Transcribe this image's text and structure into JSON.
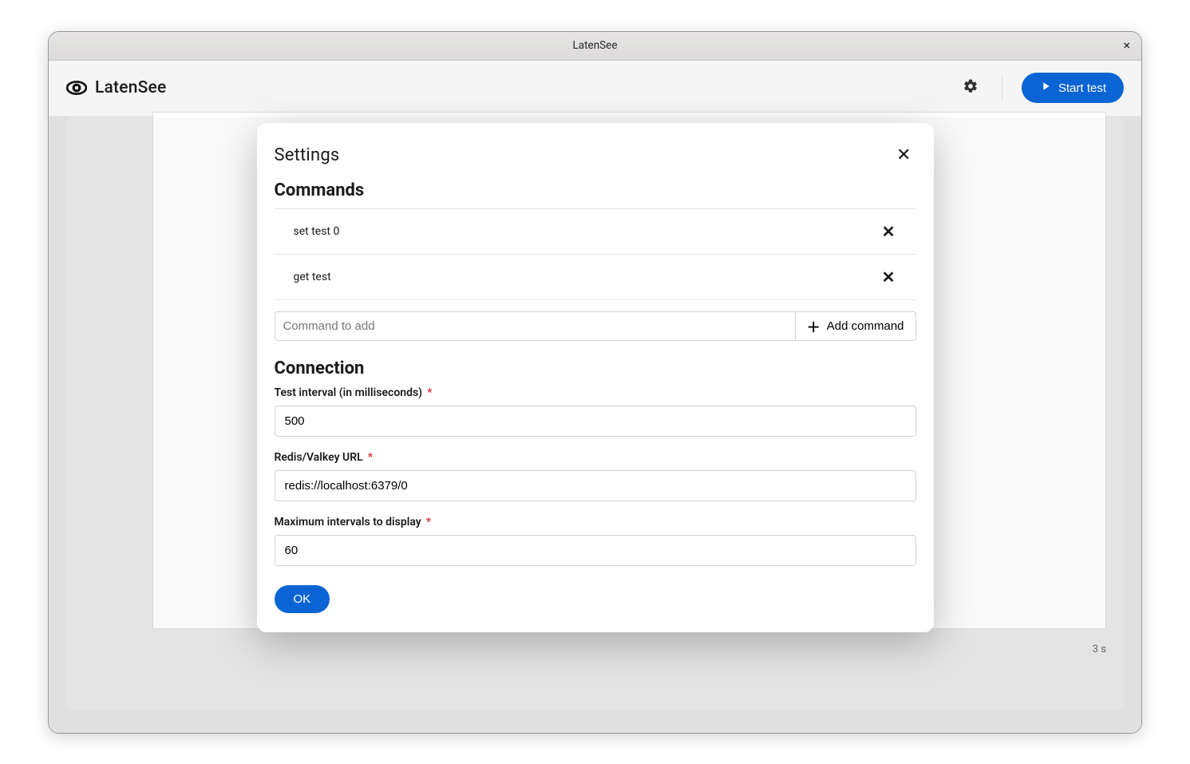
{
  "window": {
    "title": "LatenSee"
  },
  "header": {
    "brand": "LatenSee",
    "start_label": "Start test"
  },
  "background": {
    "x_tick": "3 s"
  },
  "modal": {
    "title": "Settings",
    "commands_heading": "Commands",
    "commands": [
      "set test 0",
      "get test"
    ],
    "add_placeholder": "Command to add",
    "add_label": "Add command",
    "connection_heading": "Connection",
    "fields": {
      "interval": {
        "label": "Test interval (in milliseconds)",
        "value": "500"
      },
      "url": {
        "label": "Redis/Valkey URL",
        "value": "redis://localhost:6379/0"
      },
      "max": {
        "label": "Maximum intervals to display",
        "value": "60"
      }
    },
    "ok_label": "OK"
  }
}
